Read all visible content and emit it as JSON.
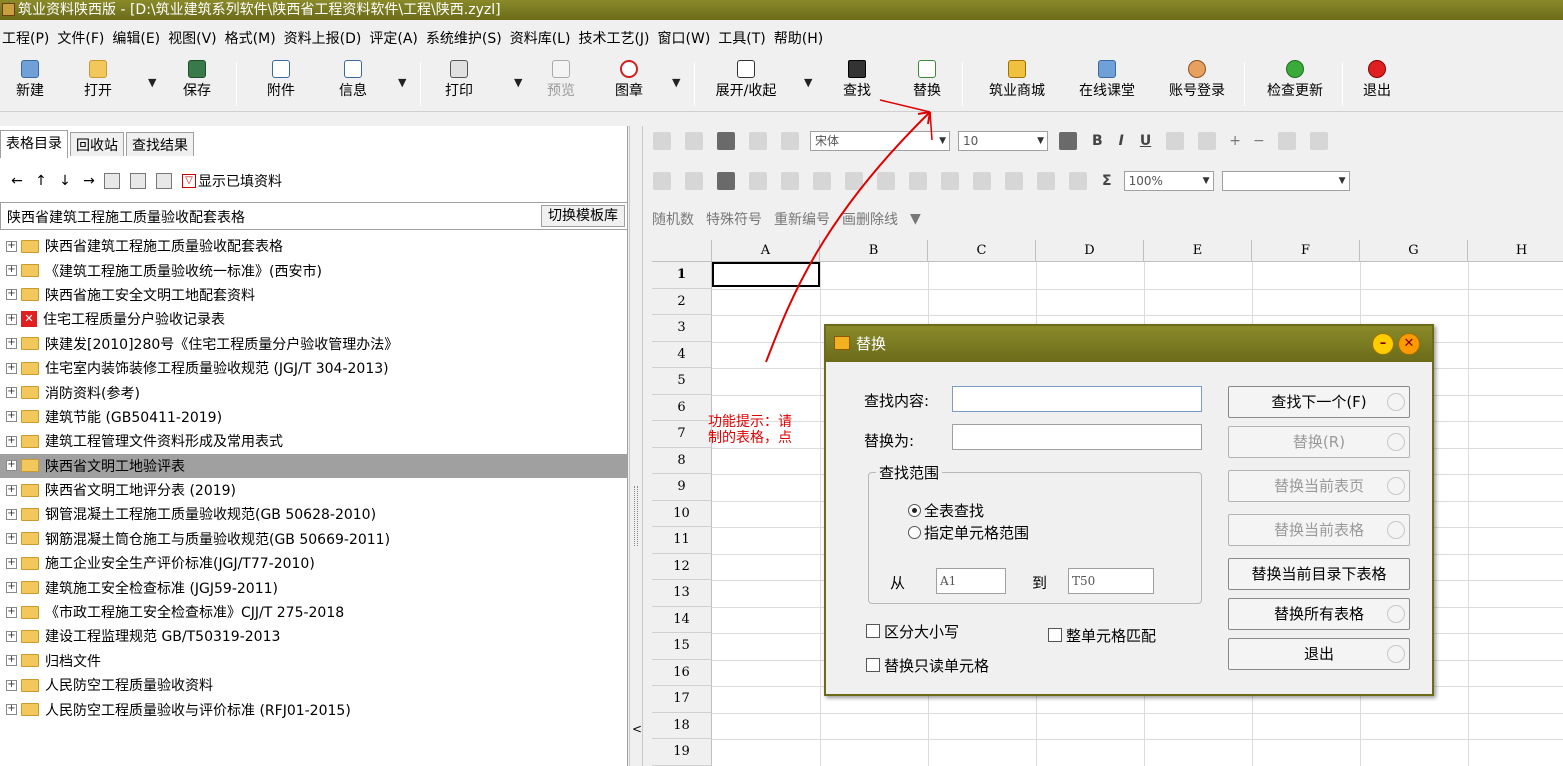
{
  "window": {
    "title": "筑业资料陕西版 - [D:\\筑业建筑系列软件\\陕西省工程资料软件\\工程\\陕西.zyzl]"
  },
  "menu": [
    "工程(P)",
    "文件(F)",
    "编辑(E)",
    "视图(V)",
    "格式(M)",
    "资料上报(D)",
    "评定(A)",
    "系统维护(S)",
    "资料库(L)",
    "技术工艺(J)",
    "窗口(W)",
    "工具(T)",
    "帮助(H)"
  ],
  "toolbar": {
    "new": "新建",
    "open": "打开",
    "save": "保存",
    "attach": "附件",
    "info": "信息",
    "print": "打印",
    "preview": "预览",
    "stamp": "图章",
    "expand": "展开/收起",
    "find": "查找",
    "replace": "替换",
    "mall": "筑业商城",
    "course": "在线课堂",
    "login": "账号登录",
    "update": "检查更新",
    "exit": "退出"
  },
  "left": {
    "tabs": [
      "表格目录",
      "回收站",
      "查找结果"
    ],
    "show_filled": "显示已填资料",
    "template_name": "陕西省建筑工程施工质量验收配套表格",
    "switch_button": "切换模板库",
    "tree": [
      "陕西省建筑工程施工质量验收配套表格",
      "《建筑工程施工质量验收统一标准》(西安市)",
      "陕西省施工安全文明工地配套资料",
      "住宅工程质量分户验收记录表",
      "陕建发[2010]280号《住宅工程质量分户验收管理办法》",
      "住宅室内装饰装修工程质量验收规范 (JGJ/T 304-2013)",
      "消防资料(参考)",
      "建筑节能 (GB50411-2019)",
      "建筑工程管理文件资料形成及常用表式",
      "陕西省文明工地验评表",
      "陕西省文明工地评分表 (2019)",
      "钢管混凝土工程施工质量验收规范(GB 50628-2010)",
      "钢筋混凝土筒仓施工与质量验收规范(GB 50669-2011)",
      "施工企业安全生产评价标准(JGJ/T77-2010)",
      "建筑施工安全检查标准 (JGJ59-2011)",
      "《市政工程施工安全检查标准》CJJ/T 275-2018",
      "建设工程监理规范 GB/T50319-2013",
      "归档文件",
      "人民防空工程质量验收资料",
      "人民防空工程质量验收与评价标准 (RFJ01-2015)"
    ],
    "selected_index": 9,
    "red_index": 3
  },
  "editor": {
    "font_name": "宋体",
    "font_size": "10",
    "zoom": "100%",
    "extra_tools": [
      "随机数",
      "特殊符号",
      "重新编号",
      "画删除线"
    ],
    "columns": [
      "A",
      "B",
      "C",
      "D",
      "E",
      "F",
      "G",
      "H"
    ],
    "rows": [
      "1",
      "2",
      "3",
      "4",
      "5",
      "6",
      "7",
      "8",
      "9",
      "10",
      "11",
      "12",
      "13",
      "14",
      "15",
      "16",
      "17",
      "18",
      "19"
    ],
    "tip_line1": "功能提示：请",
    "tip_line2": "制的表格，点"
  },
  "dialog": {
    "title": "替换",
    "find_label": "查找内容:",
    "replace_label": "替换为:",
    "find_value": "",
    "replace_value": "",
    "scope_legend": "查找范围",
    "scope_all": "全表查找",
    "scope_range": "指定单元格范围",
    "from_label": "从",
    "from_value": "A1",
    "to_label": "到",
    "to_value": "T50",
    "case_sensitive": "区分大小写",
    "whole_cell": "整单元格匹配",
    "readonly": "替换只读单元格",
    "buttons": {
      "find_next": "查找下一个(F)",
      "replace": "替换(R)",
      "replace_page": "替换当前表页",
      "replace_table": "替换当前表格",
      "replace_dir": "替换当前目录下表格",
      "replace_all": "替换所有表格",
      "exit": "退出"
    }
  },
  "colors": {
    "titlebar": "#7a7a22",
    "annotation": "#e00000",
    "selected_row": "#a0a0a0"
  }
}
